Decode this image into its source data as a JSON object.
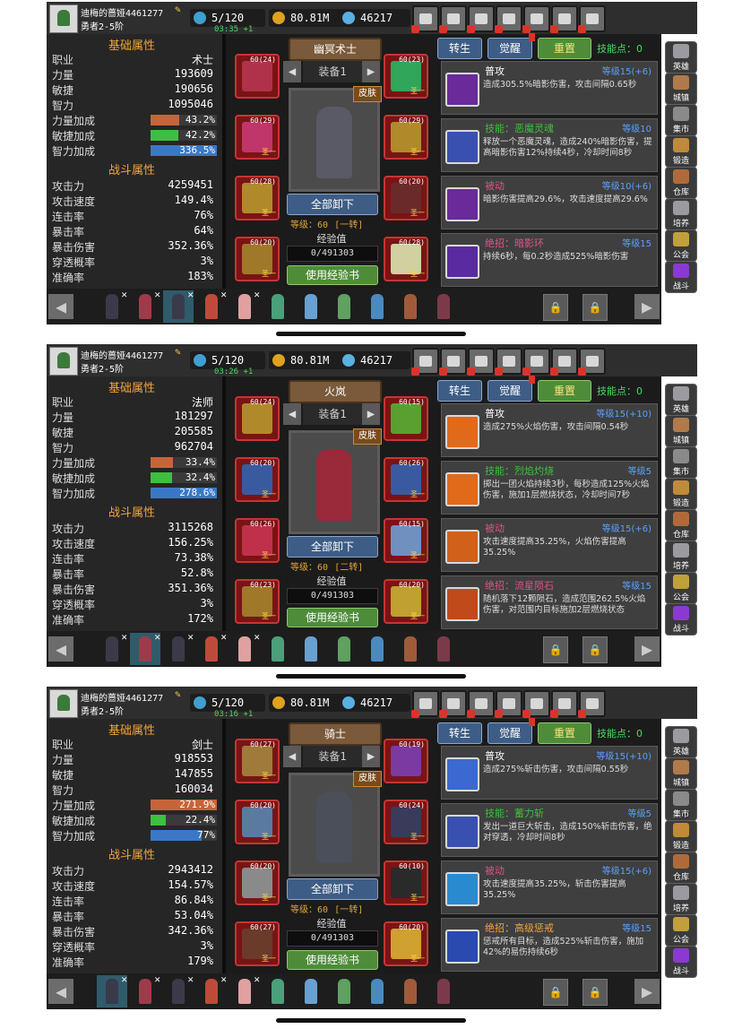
{
  "panels": [
    {
      "player": {
        "name": "迪梅的蔷娅4461277",
        "rank": "勇者2-5阶"
      },
      "resources": {
        "energy": "5/120",
        "gold": "80.81M",
        "gems": "46217"
      },
      "timer": "03:35 +1",
      "basic": {
        "title": "基础属性",
        "class_label": "职业",
        "class_value": "术士",
        "rows": [
          {
            "label": "力量",
            "value": "193609"
          },
          {
            "label": "敏捷",
            "value": "190656"
          },
          {
            "label": "智力",
            "value": "1095046"
          }
        ],
        "bars": [
          {
            "label": "力量加成",
            "value": "43.2%",
            "pct": 0.432,
            "color": "#c7643a"
          },
          {
            "label": "敏捷加成",
            "value": "42.2%",
            "pct": 0.422,
            "color": "#3fbf3f"
          },
          {
            "label": "智力加成",
            "value": "336.5%",
            "pct": 1.0,
            "color": "#3a78c7"
          }
        ]
      },
      "combat": {
        "title": "战斗属性",
        "rows": [
          {
            "label": "攻击力",
            "value": "4259451"
          },
          {
            "label": "攻击速度",
            "value": "149.4%"
          },
          {
            "label": "连击率",
            "value": "76%"
          },
          {
            "label": "暴击率",
            "value": "64%"
          },
          {
            "label": "暴击伤害",
            "value": "352.36%"
          },
          {
            "label": "穿透概率",
            "value": "3%"
          },
          {
            "label": "准确率",
            "value": "183%"
          }
        ]
      },
      "hero": {
        "title": "幽冥术士",
        "equip": "装备1",
        "skin": "皮肤",
        "unequip": "全部卸下",
        "level": "等级：60",
        "tier": "[一转]",
        "exp_label": "经验值",
        "exp": "0/491303",
        "use_exp": "使用经验书",
        "fig_color": "#5a5a66"
      },
      "slots": [
        {
          "lv": "60",
          "q": "(24)",
          "tag": "",
          "color": "#b0324a"
        },
        {
          "lv": "60",
          "q": "(23)",
          "tag": "圣一",
          "color": "#2fa65a"
        },
        {
          "lv": "60",
          "q": "(29)",
          "tag": "圣一",
          "color": "#c0356a"
        },
        {
          "lv": "60",
          "q": "(29)",
          "tag": "圣一",
          "color": "#b08a2a"
        },
        {
          "lv": "60",
          "q": "(28)",
          "tag": "圣一",
          "color": "#b08a2a"
        },
        {
          "lv": "60",
          "q": "(20)",
          "tag": "圣一",
          "color": "#6a2a2a"
        },
        {
          "lv": "60",
          "q": "(20)",
          "tag": "圣一",
          "color": "#a0782a"
        },
        {
          "lv": "60",
          "q": "(28)",
          "tag": "圣一",
          "color": "#d0d0a0"
        }
      ],
      "tabs": {
        "rebirth": "转生",
        "awaken": "觉醒",
        "reset": "重置",
        "points_label": "技能点：",
        "points": "0"
      },
      "skills": [
        {
          "name": "普攻",
          "name_color": "#ffffff",
          "level": "等级15",
          "bonus": "(+6)",
          "desc": "造成305.5%暗影伤害，攻击间隔0.65秒",
          "icon": "#6a2a9a"
        },
        {
          "name": "技能：恶魔灵魂",
          "name_color": "#3fbf3f",
          "level": "等级10",
          "bonus": "",
          "desc": "释放一个恶魔灵魂，造成240%暗影伤害，提高暗影伤害12%持续4秒，冷却时间8秒",
          "icon": "#3a50b0"
        },
        {
          "name": "被动",
          "name_color": "#e0508a",
          "level": "等级10",
          "bonus": "(+6)",
          "desc": "暗影伤害提高29.6%，攻击速度提高29.6%",
          "icon": "#6a2a9a"
        },
        {
          "name": "绝招：暗影环",
          "name_color": "#e0508a",
          "level": "等级15",
          "bonus": "",
          "desc": "持续6秒，每0.2秒造成525%暗影伤害",
          "icon": "#5a2aa0"
        }
      ],
      "selected_hero": 2
    },
    {
      "player": {
        "name": "迪梅的蔷娅4461277",
        "rank": "勇者2-5阶"
      },
      "resources": {
        "energy": "5/120",
        "gold": "80.81M",
        "gems": "46217"
      },
      "timer": "03:26 +1",
      "basic": {
        "title": "基础属性",
        "class_label": "职业",
        "class_value": "法师",
        "rows": [
          {
            "label": "力量",
            "value": "181297"
          },
          {
            "label": "敏捷",
            "value": "205585"
          },
          {
            "label": "智力",
            "value": "962704"
          }
        ],
        "bars": [
          {
            "label": "力量加成",
            "value": "33.4%",
            "pct": 0.334,
            "color": "#c7643a"
          },
          {
            "label": "敏捷加成",
            "value": "32.4%",
            "pct": 0.324,
            "color": "#3fbf3f"
          },
          {
            "label": "智力加成",
            "value": "278.6%",
            "pct": 1.0,
            "color": "#3a78c7"
          }
        ]
      },
      "combat": {
        "title": "战斗属性",
        "rows": [
          {
            "label": "攻击力",
            "value": "3115268"
          },
          {
            "label": "攻击速度",
            "value": "156.25%"
          },
          {
            "label": "连击率",
            "value": "73.38%"
          },
          {
            "label": "暴击率",
            "value": "52.8%"
          },
          {
            "label": "暴击伤害",
            "value": "351.36%"
          },
          {
            "label": "穿透概率",
            "value": "3%"
          },
          {
            "label": "准确率",
            "value": "172%"
          }
        ]
      },
      "hero": {
        "title": "火岚",
        "equip": "装备1",
        "skin": "皮肤",
        "unequip": "全部卸下",
        "level": "等级：60",
        "tier": "[二转]",
        "exp_label": "经验值",
        "exp": "0/491303",
        "use_exp": "使用经验书",
        "fig_color": "#9a2a3a"
      },
      "slots": [
        {
          "lv": "60",
          "q": "(24)",
          "tag": "",
          "color": "#b08a2a"
        },
        {
          "lv": "60",
          "q": "(15)",
          "tag": "",
          "color": "#5aa030"
        },
        {
          "lv": "60",
          "q": "(20)",
          "tag": "圣一",
          "color": "#3a5aa0"
        },
        {
          "lv": "60",
          "q": "(26)",
          "tag": "圣一",
          "color": "#3a5aa0"
        },
        {
          "lv": "60",
          "q": "(26)",
          "tag": "圣一",
          "color": "#c0304a"
        },
        {
          "lv": "60",
          "q": "(15)",
          "tag": "圣一",
          "color": "#7090c0"
        },
        {
          "lv": "60",
          "q": "(23)",
          "tag": "圣一",
          "color": "#a0782a"
        },
        {
          "lv": "60",
          "q": "(20)",
          "tag": "圣一",
          "color": "#c0a030"
        }
      ],
      "tabs": {
        "rebirth": "转生",
        "awaken": "觉醒",
        "reset": "重置",
        "points_label": "技能点：",
        "points": "0"
      },
      "skills": [
        {
          "name": "普攻",
          "name_color": "#ffffff",
          "level": "等级15",
          "bonus": "(+10)",
          "desc": "造成275%火焰伤害，攻击间隔0.54秒",
          "icon": "#e06a1a"
        },
        {
          "name": "技能：烈焰灼烧",
          "name_color": "#3fbf3f",
          "level": "等级5",
          "bonus": "",
          "desc": "掷出一团火焰持续3秒，每秒造成125%火焰伤害，施加1层燃烧状态，冷却时间7秒",
          "icon": "#e06a1a"
        },
        {
          "name": "被动",
          "name_color": "#e0508a",
          "level": "等级15",
          "bonus": "(+6)",
          "desc": "攻击速度提高35.25%，火焰伤害提高35.25%",
          "icon": "#d0601a"
        },
        {
          "name": "绝招：流星陨石",
          "name_color": "#e0508a",
          "level": "等级15",
          "bonus": "",
          "desc": "随机落下12颗陨石，造成范围262.5%火焰伤害，对范围内目标施加2层燃烧状态",
          "icon": "#c04a1a"
        }
      ],
      "selected_hero": 1
    },
    {
      "player": {
        "name": "迪梅的蔷娅4461277",
        "rank": "勇者2-5阶"
      },
      "resources": {
        "energy": "5/120",
        "gold": "80.81M",
        "gems": "46217"
      },
      "timer": "03:16 +1",
      "basic": {
        "title": "基础属性",
        "class_label": "职业",
        "class_value": "剑士",
        "rows": [
          {
            "label": "力量",
            "value": "918553"
          },
          {
            "label": "敏捷",
            "value": "147855"
          },
          {
            "label": "智力",
            "value": "160034"
          }
        ],
        "bars": [
          {
            "label": "力量加成",
            "value": "271.9%",
            "pct": 1.0,
            "color": "#c7643a"
          },
          {
            "label": "敏捷加成",
            "value": "22.4%",
            "pct": 0.224,
            "color": "#3fbf3f"
          },
          {
            "label": "智力加成",
            "value": "77%",
            "pct": 0.77,
            "color": "#3a78c7"
          }
        ]
      },
      "combat": {
        "title": "战斗属性",
        "rows": [
          {
            "label": "攻击力",
            "value": "2943412"
          },
          {
            "label": "攻击速度",
            "value": "154.57%"
          },
          {
            "label": "连击率",
            "value": "86.84%"
          },
          {
            "label": "暴击率",
            "value": "53.04%"
          },
          {
            "label": "暴击伤害",
            "value": "342.36%"
          },
          {
            "label": "穿透概率",
            "value": "3%"
          },
          {
            "label": "准确率",
            "value": "179%"
          }
        ]
      },
      "hero": {
        "title": "骑士",
        "equip": "装备1",
        "skin": "皮肤",
        "unequip": "全部卸下",
        "level": "等级：60",
        "tier": "[一转]",
        "exp_label": "经验值",
        "exp": "0/491303",
        "use_exp": "使用经验书",
        "fig_color": "#4a4f5a"
      },
      "slots": [
        {
          "lv": "60",
          "q": "(27)",
          "tag": "圣一",
          "color": "#a07a3a"
        },
        {
          "lv": "60",
          "q": "(19)",
          "tag": "",
          "color": "#7a3aa0"
        },
        {
          "lv": "60",
          "q": "(20)",
          "tag": "圣一",
          "color": "#5a7aa0"
        },
        {
          "lv": "60",
          "q": "(24)",
          "tag": "圣一",
          "color": "#3a3a5a"
        },
        {
          "lv": "60",
          "q": "(20)",
          "tag": "圣一",
          "color": "#8a8a8a"
        },
        {
          "lv": "60",
          "q": "(10)",
          "tag": "圣一",
          "color": "#2a2a2a"
        },
        {
          "lv": "60",
          "q": "(27)",
          "tag": "圣一",
          "color": "#6a3a2a"
        },
        {
          "lv": "60",
          "q": "(20)",
          "tag": "圣一",
          "color": "#d0a030"
        }
      ],
      "tabs": {
        "rebirth": "转生",
        "awaken": "觉醒",
        "reset": "重置",
        "points_label": "技能点：",
        "points": "0"
      },
      "skills": [
        {
          "name": "普攻",
          "name_color": "#ffffff",
          "level": "等级15",
          "bonus": "(+10)",
          "desc": "造成275%斩击伤害，攻击间隔0.55秒",
          "icon": "#3a6ad0"
        },
        {
          "name": "技能：蓄力斩",
          "name_color": "#3fbf3f",
          "level": "等级5",
          "bonus": "",
          "desc": "发出一道巨大斩击，造成150%斩击伤害，绝对穿透，冷却时间8秒",
          "icon": "#3a50b0"
        },
        {
          "name": "被动",
          "name_color": "#e0508a",
          "level": "等级15",
          "bonus": "(+6)",
          "desc": "攻击速度提高35.25%，斩击伤害提高35.25%",
          "icon": "#2a8ad0"
        },
        {
          "name": "绝招：高级惩戒",
          "name_color": "#f2a33a",
          "level": "等级15",
          "bonus": "",
          "desc": "惩戒所有目标，造成525%斩击伤害，施加42%的易伤持续6秒",
          "icon": "#2a4ab0"
        }
      ],
      "selected_hero": 0
    }
  ],
  "sidebar": [
    {
      "label": "英雄",
      "icon": "helmet-icon",
      "color": "#9a9aa0"
    },
    {
      "label": "城镇",
      "icon": "town-icon",
      "color": "#b07a4a"
    },
    {
      "label": "集市",
      "icon": "market-icon",
      "color": "#8a8a8a"
    },
    {
      "label": "锻造",
      "icon": "anvil-icon",
      "color": "#c08a3a"
    },
    {
      "label": "仓库",
      "icon": "warehouse-icon",
      "color": "#b06a3a"
    },
    {
      "label": "培养",
      "icon": "training-icon",
      "color": "#9a9aa0"
    },
    {
      "label": "公会",
      "icon": "guild-icon",
      "color": "#c0a03a"
    },
    {
      "label": "战斗",
      "icon": "portal-icon",
      "color": "#8a3ad0"
    }
  ],
  "top_buttons": [
    "cart-icon",
    "mail-icon",
    "gamepad-icon",
    "gear-icon",
    "gift-icon",
    "wheel-icon",
    "wand-icon"
  ],
  "hero_roster_colors": [
    "#3a3a4a",
    "#a03a4a",
    "#3a3a4a",
    "#c04a3a",
    "#e0a0a0",
    "#4aa07a",
    "#6aa0d0",
    "#60a060",
    "#4a8ac0",
    "#a05a3a",
    "#7a3a4a"
  ],
  "hero_roster_marked": [
    true,
    true,
    true,
    true,
    true,
    false,
    false,
    false,
    false,
    false,
    false
  ]
}
